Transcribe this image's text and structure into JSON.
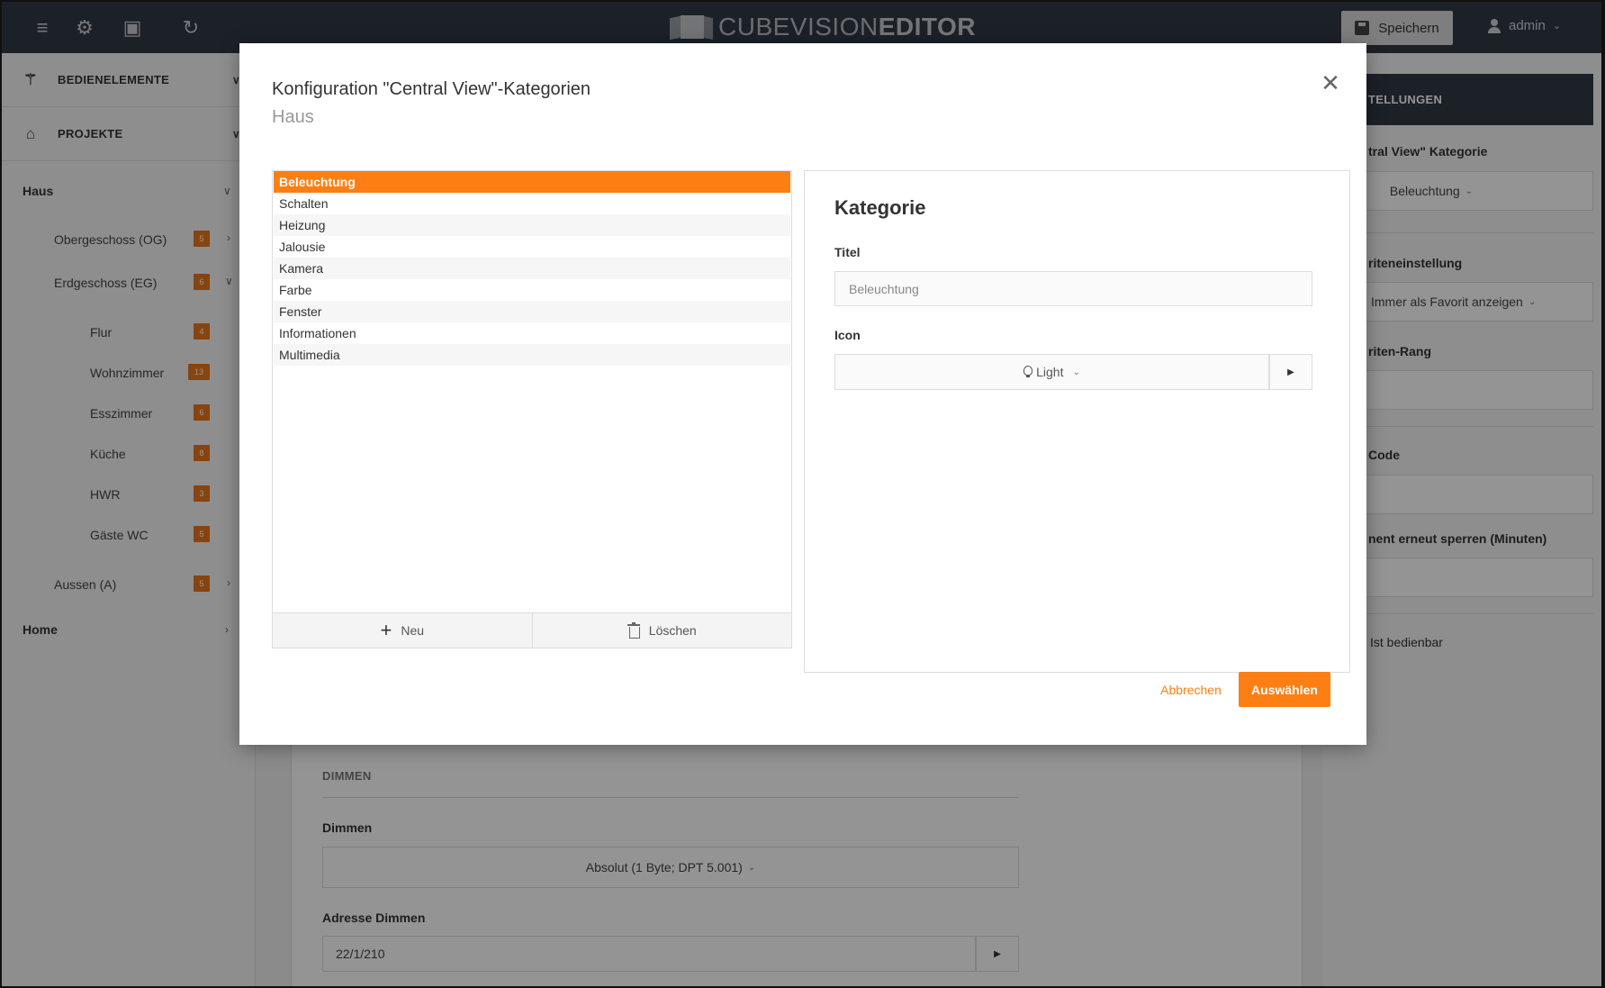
{
  "app": {
    "logo_part1": "CUBEVISION",
    "logo_part2": "EDITOR",
    "save_label": "Speichern",
    "user_label": "admin"
  },
  "sidebar": {
    "sections": [
      {
        "label": "BEDIENELEMENTE",
        "icon": "magic-wand-icon"
      },
      {
        "label": "PROJEKTE",
        "icon": "home-icon"
      }
    ],
    "tree_root": "Haus",
    "floors": [
      {
        "label": "Obergeschoss (OG)",
        "count": "5"
      },
      {
        "label": "Erdgeschoss (EG)",
        "count": "6"
      },
      {
        "label": "Aussen (A)",
        "count": "5"
      }
    ],
    "rooms": [
      {
        "label": "Flur",
        "count": "4"
      },
      {
        "label": "Wohnzimmer",
        "count": "13"
      },
      {
        "label": "Esszimmer",
        "count": "6"
      },
      {
        "label": "Küche",
        "count": "8"
      },
      {
        "label": "HWR",
        "count": "3"
      },
      {
        "label": "Gäste WC",
        "count": "5"
      }
    ],
    "home_label": "Home"
  },
  "main": {
    "section_title": "DIMMEN",
    "dimmen_label": "Dimmen",
    "dimmen_value": "Absolut (1 Byte; DPT 5.001)",
    "adresse_label": "Adresse Dimmen",
    "adresse_value": "22/1/210"
  },
  "right_panel": {
    "header": "TELLUNGEN",
    "cat_label": "tral View\" Kategorie",
    "cat_value": "Beleuchtung",
    "fav_label": "riteneinstellung",
    "fav_value": "Immer als Favorit anzeigen",
    "rang_label": "riten-Rang",
    "code_label": "Code",
    "sperren_label": "nent erneut sperren (Minuten)",
    "bedienbar_label": "Ist bedienbar"
  },
  "modal": {
    "title": "Konfiguration \"Central View\"-Kategorien",
    "subtitle": "Haus",
    "categories": [
      "Beleuchtung",
      "Schalten",
      "Heizung",
      "Jalousie",
      "Kamera",
      "Farbe",
      "Fenster",
      "Informationen",
      "Multimedia"
    ],
    "selected_index": 0,
    "new_label": "Neu",
    "delete_label": "Löschen",
    "detail_heading": "Kategorie",
    "titel_label": "Titel",
    "titel_value": "Beleuchtung",
    "icon_label": "Icon",
    "icon_value": "Light",
    "cancel_label": "Abbrechen",
    "ok_label": "Auswählen"
  },
  "colors": {
    "accent": "#fd7f13",
    "topbar": "#313a44",
    "badge": "#e8761a"
  }
}
